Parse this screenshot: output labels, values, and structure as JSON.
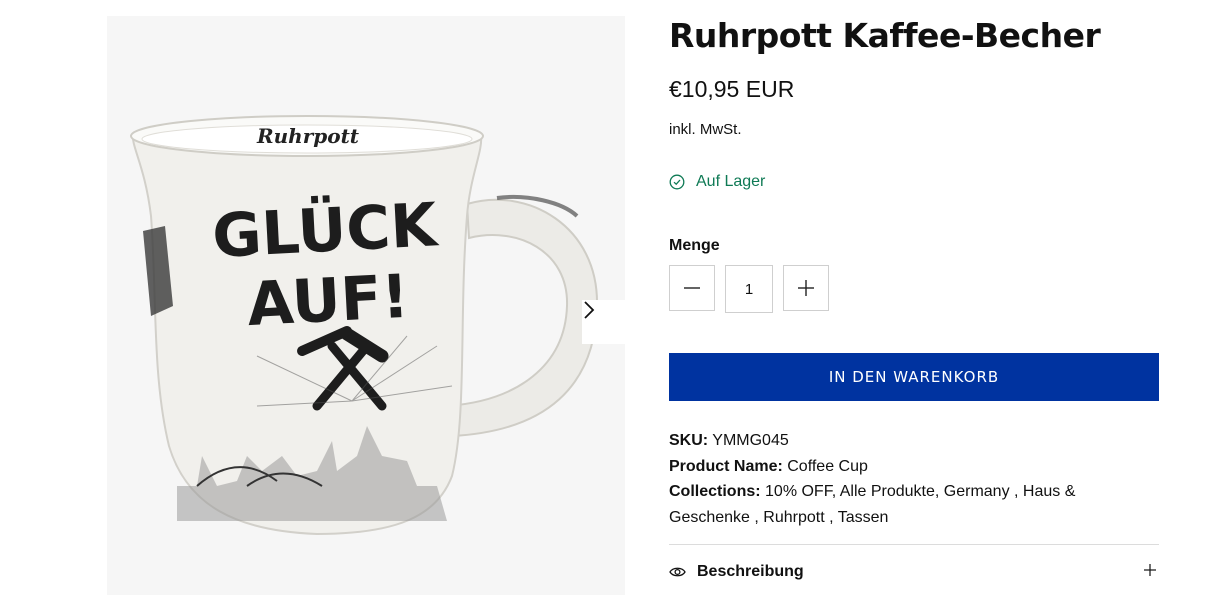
{
  "product": {
    "title": "Ruhrpott Kaffee-Becher",
    "price": "€10,95 EUR",
    "tax_note": "inkl. MwSt.",
    "stock_status": "Auf Lager",
    "quantity_label": "Menge",
    "quantity_value": "1",
    "add_to_cart_label": "IN DEN WARENKORB"
  },
  "mug_print": {
    "brand": "Ruhrpott",
    "slogan_line1": "GLÜCK",
    "slogan_line2": "AUF!"
  },
  "details": {
    "sku_label": "SKU:",
    "sku_value": "YMMG045",
    "name_label": "Product Name:",
    "name_value": "Coffee Cup",
    "collections_label": "Collections:",
    "collections_value": "10% OFF, Alle Produkte, Germany , Haus & Geschenke , Ruhrpott , Tassen"
  },
  "accordion": {
    "description_label": "Beschreibung"
  },
  "colors": {
    "accent": "#0033a0",
    "stock": "#0f7a55",
    "gallery_bg": "#f6f6f6"
  },
  "icons": {
    "next": "chevron-right-icon",
    "stock": "check-circle-icon",
    "minus": "minus-icon",
    "plus": "plus-icon",
    "description": "eye-icon",
    "expand": "plus-icon"
  }
}
